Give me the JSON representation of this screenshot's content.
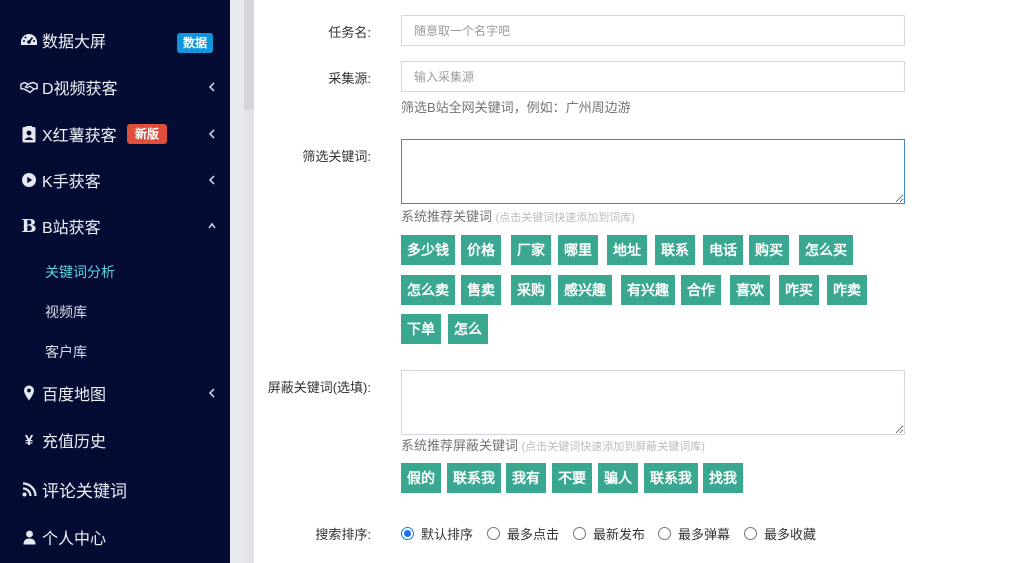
{
  "sidebar": {
    "items": [
      {
        "label": "数据大屏",
        "icon": "dashboard-icon",
        "badge": "数据"
      },
      {
        "label": "D视频获客",
        "icon": "handshake-icon"
      },
      {
        "label": "X红薯获客",
        "icon": "contact-card-icon",
        "badge": "新版"
      },
      {
        "label": "K手获客",
        "icon": "play-circle-icon"
      },
      {
        "label": "B站获客",
        "icon": "letter-b-icon"
      },
      {
        "label": "百度地图",
        "icon": "map-marker-icon"
      },
      {
        "label": "充值历史",
        "icon": "yen-icon",
        "icon_glyph": "¥"
      },
      {
        "label": "评论关键词",
        "icon": "rss-icon"
      },
      {
        "label": "个人中心",
        "icon": "user-icon"
      }
    ],
    "sub_items": [
      "关键词分析",
      "视频库",
      "客户库"
    ]
  },
  "form": {
    "task_name": {
      "label": "任务名:",
      "placeholder": "随意取一个名字吧",
      "value": ""
    },
    "source": {
      "label": "采集源:",
      "placeholder": "输入采集源",
      "value": "",
      "help": "筛选B站全网关键词，例如：广州周边游"
    },
    "filter_keywords": {
      "label": "筛选关键词:",
      "value": "",
      "recommend_title": "系统推荐关键词",
      "recommend_hint": "(点击关键词快速添加到词库)",
      "tags": [
        "多少钱",
        "价格",
        "厂家",
        "哪里",
        "地址",
        "联系",
        "电话",
        "购买",
        "怎么买",
        "怎么卖",
        "售卖",
        "采购",
        "感兴趣",
        "有兴趣",
        "合作",
        "喜欢",
        "咋买",
        "咋卖",
        "下单",
        "怎么"
      ]
    },
    "block_keywords": {
      "label": "屏蔽关键词(选填):",
      "value": "",
      "recommend_title": "系统推荐屏蔽关键词",
      "recommend_hint": "(点击关键词快速添加到屏蔽关键词库)",
      "tags": [
        "假的",
        "联系我",
        "我有",
        "不要",
        "骗人",
        "联系我",
        "找我"
      ]
    },
    "sort": {
      "label": "搜索排序:",
      "options": [
        "默认排序",
        "最多点击",
        "最新发布",
        "最多弹幕",
        "最多收藏"
      ],
      "selected": "默认排序"
    }
  },
  "colors": {
    "sidebar_bg": "#050c33",
    "tag_green": "#3aa890",
    "badge_blue": "#1296db",
    "badge_red": "#e04f3c",
    "active_sub": "#5ad0e4"
  }
}
